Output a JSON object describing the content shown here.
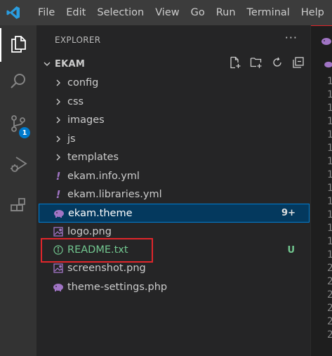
{
  "menu": [
    "File",
    "Edit",
    "Selection",
    "View",
    "Go",
    "Run",
    "Terminal",
    "Help"
  ],
  "activity": {
    "source_control_badge": "1"
  },
  "explorer": {
    "header": "EXPLORER",
    "more": "···",
    "folder_name": "EKAM",
    "items": [
      {
        "label": "config",
        "type": "folder",
        "status": ""
      },
      {
        "label": "css",
        "type": "folder",
        "status": ""
      },
      {
        "label": "images",
        "type": "folder",
        "status": ""
      },
      {
        "label": "js",
        "type": "folder",
        "status": ""
      },
      {
        "label": "templates",
        "type": "folder",
        "status": ""
      },
      {
        "label": "ekam.info.yml",
        "type": "yml",
        "status": ""
      },
      {
        "label": "ekam.libraries.yml",
        "type": "yml",
        "status": ""
      },
      {
        "label": "ekam.theme",
        "type": "php",
        "status": "9+"
      },
      {
        "label": "logo.png",
        "type": "image",
        "status": ""
      },
      {
        "label": "README.txt",
        "type": "info",
        "status": "U"
      },
      {
        "label": "screenshot.png",
        "type": "image",
        "status": ""
      },
      {
        "label": "theme-settings.php",
        "type": "php",
        "status": ""
      }
    ]
  },
  "editor": {
    "line_numbers": [
      "1",
      "1",
      "1",
      "1",
      "1",
      "1",
      "1",
      "1",
      "1",
      "1",
      "1",
      "1",
      "1",
      "1",
      "2",
      "2",
      "2",
      "2",
      "2",
      "2"
    ]
  },
  "colors": {
    "accent": "#007acc",
    "selection": "#04395e",
    "untracked": "#73c991",
    "highlight_box": "#e0262b"
  }
}
